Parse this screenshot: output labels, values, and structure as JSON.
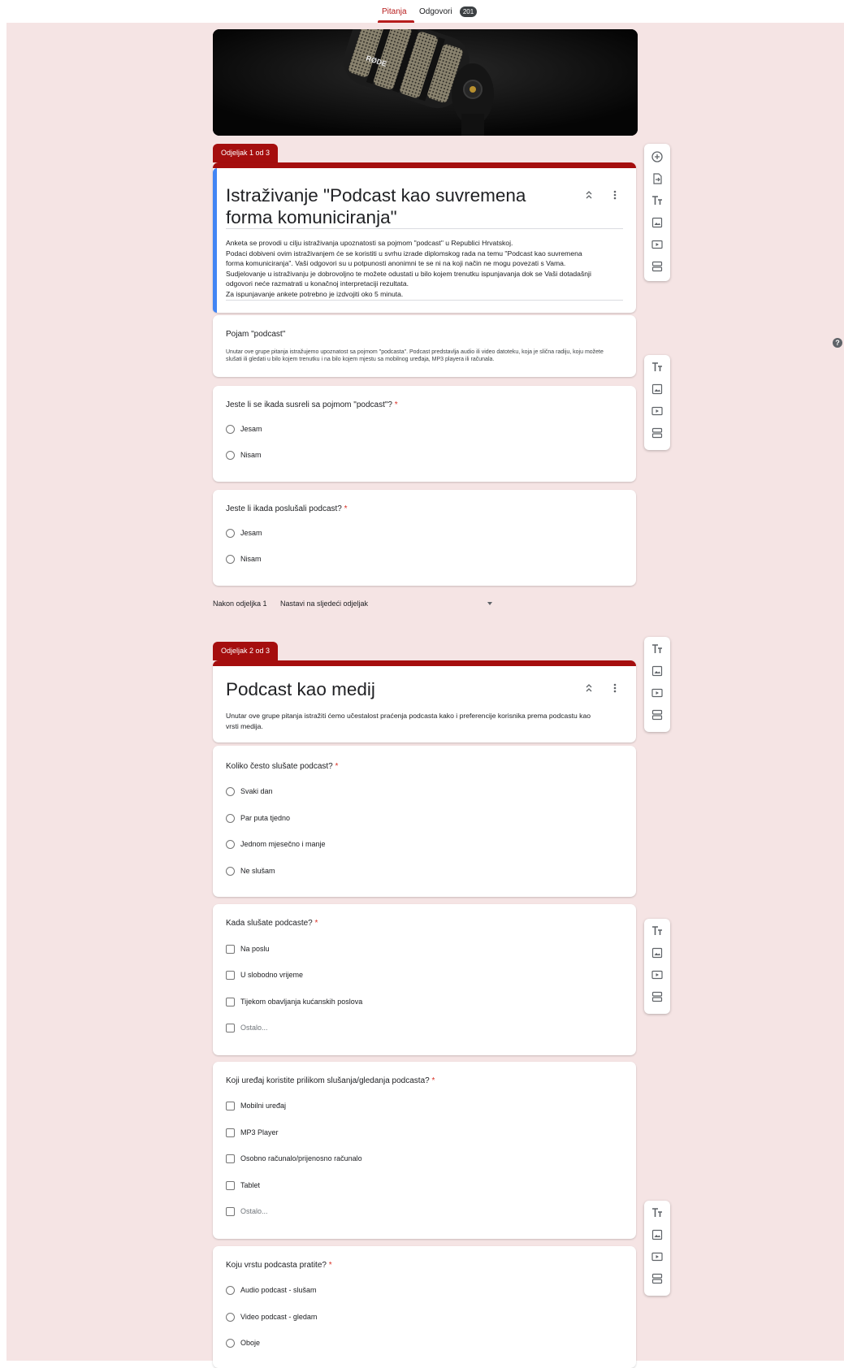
{
  "tabs": {
    "questions": "Pitanja",
    "responses": "Odgovori",
    "responses_count": "201"
  },
  "header_image": {
    "brand_text": "RØDE"
  },
  "section1": {
    "tab_label": "Odjeljak 1 od 3",
    "title": "Istraživanje \"Podcast kao suvremena forma komuniciranja\"",
    "description": "Anketa se provodi u cilju istraživanja upoznatosti sa pojmom \"podcast\" u Republici Hrvatskoj.\nPodaci dobiveni ovim istraživanjem će se koristiti u svrhu izrade diplomskog rada na temu \"Podcast kao suvremena forma komuniciranja\".  Vaši odgovori su u potpunosti anonimni te se ni na koji način ne mogu povezati s Vama. Sudjelovanje u istraživanju je dobrovoljno te možete odustati u bilo kojem trenutku ispunjavanja dok se Vaši dotadašnji odgovori neće razmatrati u konačnoj interpretaciji rezultata.\nZa ispunjavanje ankete potrebno je izdvojiti oko 5 minuta."
  },
  "title_block": {
    "title": "Pojam \"podcast\"",
    "description": "Unutar ove grupe pitanja istražujemo upoznatost sa pojmom \"podcasta\". Podcast predstavlja audio ili video datoteku, koja je slična radiju, koju možete slušati ili gledati u bilo kojem trenutku i na bilo kojem mjestu sa mobilnog uređaja, MP3 playera ili računala."
  },
  "questions": [
    {
      "title": "Jeste li se ikada susreli sa pojmom \"podcast\"?",
      "required": "*",
      "type": "radio",
      "options": [
        "Jesam",
        "Nisam"
      ]
    },
    {
      "title": "Jeste li ikada poslušali podcast?",
      "required": "*",
      "type": "radio",
      "options": [
        "Jesam",
        "Nisam"
      ]
    },
    {
      "title": "Koliko često slušate podcast?",
      "required": "*",
      "type": "radio",
      "options": [
        "Svaki dan",
        "Par puta tjedno",
        "Jednom mjesečno i manje",
        "Ne slušam"
      ]
    },
    {
      "title": "Kada slušate podcaste?",
      "required": "*",
      "type": "checkbox",
      "options": [
        "Na poslu",
        "U slobodno vrijeme",
        "Tijekom obavljanja kućanskih poslova",
        "Ostalo..."
      ]
    },
    {
      "title": "Koji uređaj koristite prilikom slušanja/gledanja podcasta?",
      "required": "*",
      "type": "checkbox",
      "options": [
        "Mobilni uređaj",
        "MP3 Player",
        "Osobno računalo/prijenosno računalo",
        "Tablet",
        "Ostalo..."
      ]
    },
    {
      "title": "Koju vrstu podcasta pratite?",
      "required": "*",
      "type": "radio",
      "options": [
        "Audio podcast - slušam",
        "Video podcast - gledam",
        "Oboje"
      ]
    }
  ],
  "after_section": {
    "label": "Nakon odjeljka 1",
    "value": "Nastavi na sljedeći odjeljak"
  },
  "section2": {
    "tab_label": "Odjeljak 2 od 3",
    "title": "Podcast kao medij",
    "description": "Unutar ove grupe pitanja istražiti ćemo učestalost praćenja podcasta kako i preferencije korisnika prema podcastu kao vrsti medija."
  },
  "help": {
    "label": "?"
  },
  "icons": {
    "add": "add-question-icon",
    "import": "import-questions-icon",
    "title": "add-title-icon",
    "image": "add-image-icon",
    "video": "add-video-icon",
    "section": "add-section-icon",
    "collapse": "collapse-icon",
    "more": "more-vert-icon"
  },
  "colors": {
    "accent": "#a50e0e",
    "background": "#f5e4e4",
    "focus": "#4285f4"
  }
}
